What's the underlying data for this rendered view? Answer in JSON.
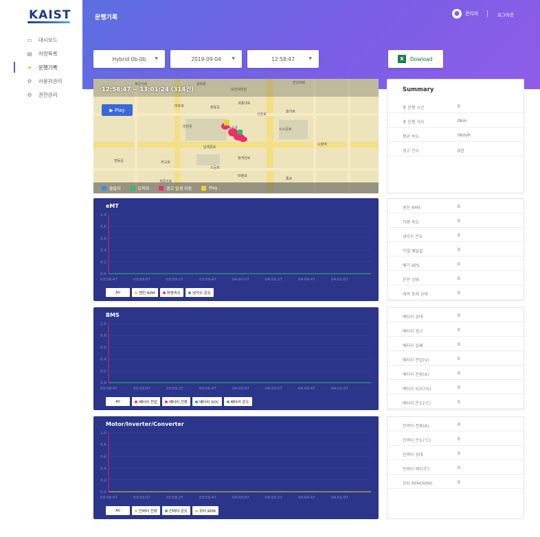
{
  "brand": {
    "logo": "KAIST"
  },
  "sidebar": {
    "items": [
      {
        "label": "대시보드",
        "icon": "monitor-icon",
        "glyph": "▭"
      },
      {
        "label": "차량목록",
        "icon": "vehicle-list-icon",
        "glyph": "▤"
      },
      {
        "label": "운행기록",
        "icon": "driving-log-icon",
        "glyph": "≡"
      },
      {
        "label": "사용자관리",
        "icon": "user-gear-icon",
        "glyph": "⚙"
      },
      {
        "label": "권한관리",
        "icon": "permission-icon",
        "glyph": "⚙"
      }
    ],
    "active_index": 2
  },
  "header": {
    "title": "운행기록",
    "user_name": "관리자",
    "logout": "로그아웃",
    "gradient": [
      "#5b6fe0",
      "#8e5de8"
    ]
  },
  "filters": {
    "vehicle": "Hybrid 0b-0b",
    "date": "2019-09-04",
    "time": "12:58:47"
  },
  "download": {
    "label": "Dowload"
  },
  "map": {
    "time_range": "12:58:47 ~ 13:01:24 (314건)",
    "play_label": "▶ Play",
    "legend": [
      {
        "label": "출발지",
        "color": "#3b8de0"
      },
      {
        "label": "도착지",
        "color": "#2bbf6a"
      },
      {
        "label": "경고 발생 지점",
        "color": "#e8316a"
      },
      {
        "label": "Play",
        "color": "#f2d22e"
      }
    ],
    "places": [
      "봉은사로",
      "광화문",
      "보건대학원",
      "한강대로",
      "마포로",
      "정동길",
      "세종대로",
      "신촌로",
      "을지로",
      "대한문",
      "덕수궁",
      "서소문로",
      "시청역",
      "명동길",
      "무교로",
      "청계천로",
      "남대문로",
      "소공로",
      "태평로",
      "종로",
      "새문안로"
    ]
  },
  "charts": [
    {
      "title": "eMT",
      "yticks": [
        "1.0",
        "0.8",
        "0.6",
        "0.4",
        "0.2",
        "0.0"
      ],
      "xticks": [
        "03:58:47",
        "03:59:07",
        "03:59:27",
        "03:59:47",
        "04:00:07",
        "04:00:27",
        "04:00:47",
        "04:01:07"
      ],
      "legend": [
        {
          "label": "All",
          "color": ""
        },
        {
          "label": "엔진 RPM",
          "color": "#f2d22e"
        },
        {
          "label": "차량속도",
          "color": "#e8316a"
        },
        {
          "label": "냉각수 온도",
          "color": "#3b8de0"
        }
      ],
      "line_color": "#2bbf6a"
    },
    {
      "title": "BMS",
      "yticks": [
        "1.0",
        "0.8",
        "0.6",
        "0.4",
        "0.2",
        "0.0"
      ],
      "xticks": [
        "03:58:47",
        "03:59:07",
        "03:59:27",
        "03:59:47",
        "04:00:07",
        "04:00:27",
        "04:00:47",
        "04:01:07"
      ],
      "legend": [
        {
          "label": "All",
          "color": ""
        },
        {
          "label": "배터리 전압",
          "color": "#e8316a"
        },
        {
          "label": "배터리 전류",
          "color": "#e8316a"
        },
        {
          "label": "배터리 SOC",
          "color": "#3b8de0"
        },
        {
          "label": "배터리 온도",
          "color": "#2bbf6a"
        }
      ],
      "line_color": "#2bbf6a"
    },
    {
      "title": "Motor/Inverter/Converter",
      "yticks": [
        "1.0",
        "0.8",
        "0.6",
        "0.4",
        "0.2",
        "0.0"
      ],
      "xticks": [
        "03:58:47",
        "03:59:07",
        "03:59:27",
        "03:59:47",
        "04:00:07",
        "04:00:27",
        "04:00:47",
        "04:01:07"
      ],
      "legend": [
        {
          "label": "All",
          "color": ""
        },
        {
          "label": "인버터 전류",
          "color": "#f2d22e"
        },
        {
          "label": "인버터 온도",
          "color": "#2bbf6a"
        },
        {
          "label": "모터 RPM",
          "color": "#f2d22e"
        }
      ],
      "line_color": "#f2d22e"
    }
  ],
  "summary": {
    "title": "Summary",
    "rows": [
      {
        "k": "총 운행 시간",
        "v": "0"
      },
      {
        "k": "총 운행 거리",
        "v": "0km"
      },
      {
        "k": "평균 속도",
        "v": "0km/h"
      },
      {
        "k": "경고 건수",
        "v": "0건"
      }
    ]
  },
  "emt_info": [
    {
      "k": "엔진 RPM",
      "v": "0"
    },
    {
      "k": "차량 속도",
      "v": "0"
    },
    {
      "k": "냉각수 온도",
      "v": "0"
    },
    {
      "k": "악셀 페달값",
      "v": "0"
    },
    {
      "k": "배기 APS",
      "v": "0"
    },
    {
      "k": "운전 상태",
      "v": "0"
    },
    {
      "k": "레버 포제 상태",
      "v": "0"
    }
  ],
  "bms_info": [
    {
      "k": "배터리 상태",
      "v": "0"
    },
    {
      "k": "배터리 경고",
      "v": "0"
    },
    {
      "k": "배터리 실패",
      "v": "0"
    },
    {
      "k": "배터리 전압(V)",
      "v": "0"
    },
    {
      "k": "배터리 전류(A)",
      "v": "0"
    },
    {
      "k": "배터리 SOC(%)",
      "v": "0"
    },
    {
      "k": "배터리 온도(℃)",
      "v": "0"
    }
  ],
  "motor_info": [
    {
      "k": "인버터 전류(A)",
      "v": "0"
    },
    {
      "k": "인버터 온도(℃)",
      "v": "0"
    },
    {
      "k": "인버터 상태",
      "v": "0"
    },
    {
      "k": "인버터 에러코드",
      "v": "0"
    },
    {
      "k": "모터 RPM(RPM)",
      "v": "0"
    }
  ]
}
